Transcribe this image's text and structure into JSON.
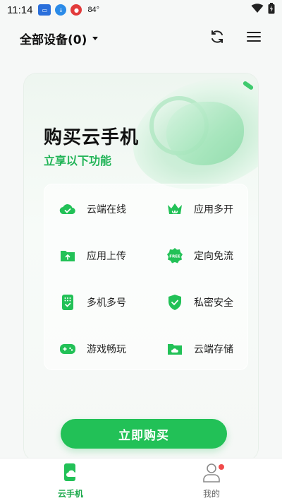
{
  "status_bar": {
    "time": "11:14",
    "temperature": "84°",
    "icons": [
      "notification-app-icon",
      "download-icon",
      "weather-icon",
      "wifi-icon",
      "battery-icon"
    ]
  },
  "header": {
    "device_select_label": "全部设备(0)",
    "icons": [
      "refresh-icon",
      "menu-icon"
    ]
  },
  "promo": {
    "title": "购买云手机",
    "subtitle": "立享以下功能",
    "features": [
      {
        "label": "云端在线",
        "icon": "cloud-check-icon"
      },
      {
        "label": "应用多开",
        "icon": "crown-icon"
      },
      {
        "label": "应用上传",
        "icon": "folder-upload-icon"
      },
      {
        "label": "定向免流",
        "icon": "free-badge-icon"
      },
      {
        "label": "多机多号",
        "icon": "phone-grid-icon"
      },
      {
        "label": "私密安全",
        "icon": "shield-check-icon"
      },
      {
        "label": "游戏畅玩",
        "icon": "gamepad-icon"
      },
      {
        "label": "云端存储",
        "icon": "folder-cloud-icon"
      }
    ],
    "buy_button_label": "立即购买"
  },
  "bottom_nav": {
    "items": [
      {
        "label": "云手机",
        "icon": "cloud-phone-icon",
        "active": true
      },
      {
        "label": "我的",
        "icon": "person-icon",
        "active": false
      }
    ]
  },
  "colors": {
    "accent": "#22c157",
    "accent_text": "#21b457",
    "badge": "#f04b4b"
  }
}
